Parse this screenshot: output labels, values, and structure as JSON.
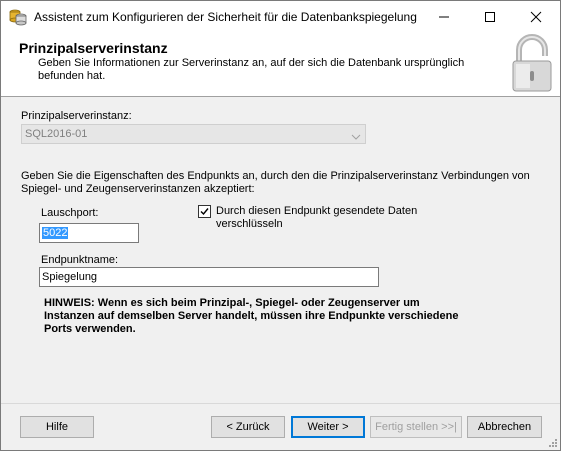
{
  "window": {
    "title": "Assistent zum Konfigurieren der Sicherheit für die Datenbankspiegelung"
  },
  "header": {
    "title": "Prinzipalserverinstanz",
    "description": "Geben Sie Informationen zur Serverinstanz an, auf der sich die Datenbank ursprünglich befunden hat."
  },
  "form": {
    "instance_label": "Prinzipalserverinstanz:",
    "instance_value": "SQL2016-01",
    "endpoint_desc": "Geben Sie die Eigenschaften des Endpunkts an, durch den die Prinzipalserverinstanz Verbindungen von Spiegel- und Zeugenserverinstanzen akzeptiert:",
    "port_label": "Lauschport:",
    "port_value": "5022",
    "encrypt_label": "Durch diesen Endpunkt gesendete Daten verschlüsseln",
    "encrypt_checked": true,
    "endpoint_name_label": "Endpunktname:",
    "endpoint_name_value": "Spiegelung",
    "note": "HINWEIS: Wenn es sich beim Prinzipal-, Spiegel- oder Zeugenserver um Instanzen auf demselben Server handelt, müssen ihre Endpunkte verschiedene Ports verwenden."
  },
  "buttons": {
    "help": "Hilfe",
    "back": "< Zurück",
    "next": "Weiter >",
    "finish": "Fertig stellen >>|",
    "cancel": "Abbrechen"
  },
  "icons": {
    "app": "database-mirroring-icon",
    "header": "lock-icon"
  }
}
